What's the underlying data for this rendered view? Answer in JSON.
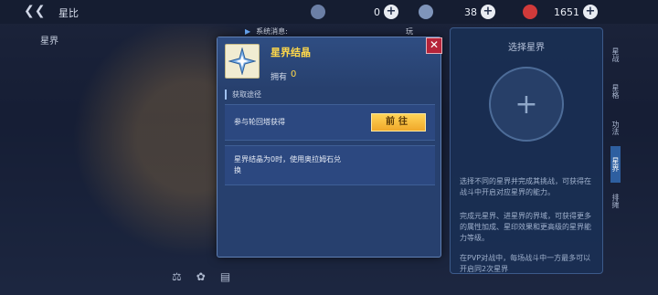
{
  "topbar": {
    "page_name": "星比",
    "resources": [
      {
        "name": "resource-1",
        "value": "0",
        "icon": "crystal-icon",
        "color": "#8fa0c0"
      },
      {
        "name": "resource-2",
        "value": "38",
        "icon": "gem-icon",
        "color": "#9fb3d6"
      },
      {
        "name": "resource-3",
        "value": "1651",
        "icon": "red-gem-icon",
        "color": "#e04040"
      }
    ]
  },
  "left": {
    "tab_label": "星界"
  },
  "notice": {
    "label": "系统消息:",
    "tail": "玩"
  },
  "modal": {
    "item_name": "星界结晶",
    "own_label": "拥有",
    "own_value": "0",
    "section_label": "获取途径",
    "rows": [
      {
        "text": "参与轮回塔获得",
        "button": "前往"
      },
      {
        "text_line1": "星界结晶为0时，使用奥拉姆石兑",
        "text_line2": "换"
      }
    ]
  },
  "right_panel": {
    "title": "选择星界",
    "p1": "选择不同的星界并完成其挑战，可获得在战斗中开启对应星界的能力。",
    "p2": "完成元星界、进星界的界域，可获得更多的属性加成、星印效果和更高级的星界能力等级。",
    "p3": "在PVP对战中，每场战斗中一方最多可以开启同2次星界"
  },
  "side_tabs": [
    "星战",
    "星格",
    "功法",
    "星界",
    "排摊"
  ],
  "colors": {
    "accent": "#ffd84a",
    "modal_bg": "#27406e",
    "button": "#f0a82a",
    "close": "#b6243a"
  }
}
